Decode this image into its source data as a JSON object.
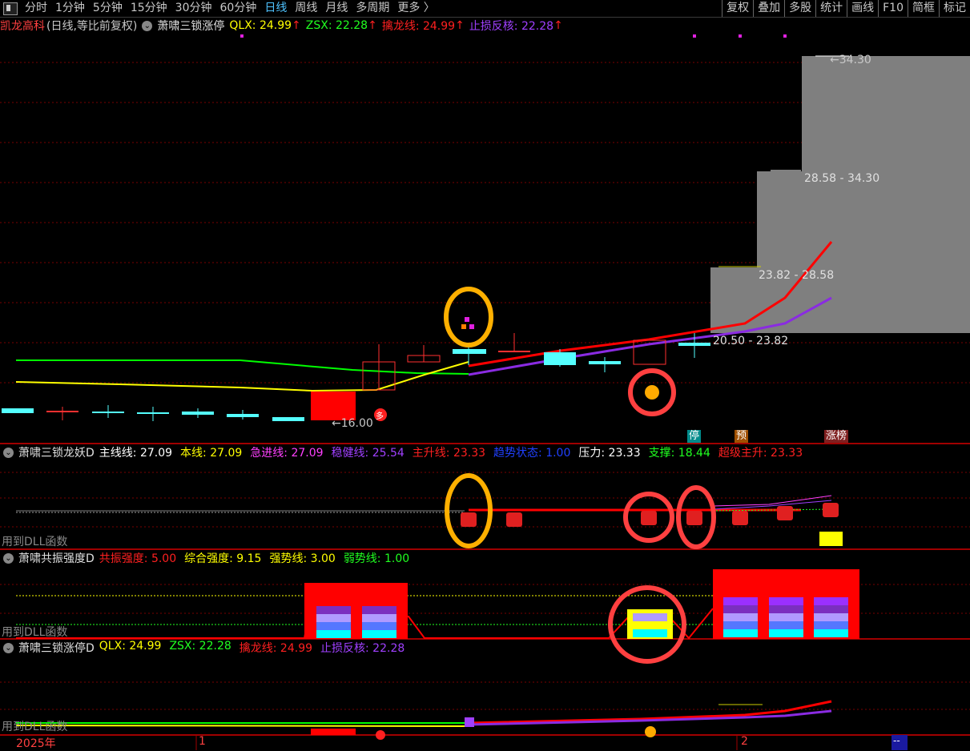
{
  "toolbar": {
    "periods": [
      "分时",
      "1分钟",
      "5分钟",
      "15分钟",
      "30分钟",
      "60分钟",
      "日线",
      "周线",
      "月线",
      "多周期",
      "更多 〉"
    ],
    "active": "日线",
    "right": [
      "复权",
      "叠加",
      "多股",
      "统计",
      "画线",
      "F10",
      "简框",
      "标记"
    ]
  },
  "main": {
    "stock": "凯龙高科",
    "mode": "(日线,等比前复权)",
    "indicator": "萧啸三锁涨停",
    "qlx": "QLX: 24.99",
    "zsx": "ZSX: 22.28",
    "qinlong": "擒龙线: 24.99",
    "zhisun": "止损反核: 22.28",
    "low_label": "←16.00",
    "high_label": "←34.30",
    "zones": [
      "28.58 - 34.30",
      "23.82 - 28.58",
      "20.50 - 23.82"
    ],
    "tags": [
      "停",
      "预",
      "涨榜"
    ],
    "duo": "多"
  },
  "p2": {
    "name": "萧啸三锁龙妖D",
    "items": [
      {
        "t": "主线线: 27.09",
        "c": "#ffffff"
      },
      {
        "t": "本线: 27.09",
        "c": "#ffff00"
      },
      {
        "t": "急进线: 27.09",
        "c": "#ff40ff"
      },
      {
        "t": "稳健线: 25.54",
        "c": "#a040ff"
      },
      {
        "t": "主升线: 23.33",
        "c": "#ff2020"
      },
      {
        "t": "趋势状态: 1.00",
        "c": "#2040ff"
      },
      {
        "t": "压力: 23.33",
        "c": "#ffffff"
      },
      {
        "t": "支撑: 18.44",
        "c": "#20ff20"
      },
      {
        "t": "超级主升: 23.33",
        "c": "#ff2020"
      }
    ],
    "dll": "用到DLL函数"
  },
  "p3": {
    "name": "萧啸共振强度D",
    "items": [
      {
        "t": "共振强度: 5.00",
        "c": "#ff2020"
      },
      {
        "t": "综合强度: 9.15",
        "c": "#ffff00"
      },
      {
        "t": "强势线: 3.00",
        "c": "#ffff00"
      },
      {
        "t": "弱势线: 1.00",
        "c": "#20ff20"
      }
    ],
    "dll": "用到DLL函数"
  },
  "p4": {
    "name": "萧啸三锁涨停D",
    "items": [
      {
        "t": "QLX: 24.99",
        "c": "#ffff00"
      },
      {
        "t": "ZSX: 22.28",
        "c": "#20ff20"
      },
      {
        "t": "擒龙线: 24.99",
        "c": "#ff2020"
      },
      {
        "t": "止损反核: 22.28",
        "c": "#a040ff"
      }
    ],
    "dll": "用到DLL函数"
  },
  "axis": {
    "year": "2025年",
    "m1": "1",
    "m2": "2",
    "end": "--"
  },
  "colors": {
    "red": "#ff0000",
    "cyan": "#54ffff",
    "yellow": "#ffff00",
    "green": "#00ff00",
    "purple": "#9b30ff",
    "grey": "#808080",
    "grid": "#8b0000"
  }
}
